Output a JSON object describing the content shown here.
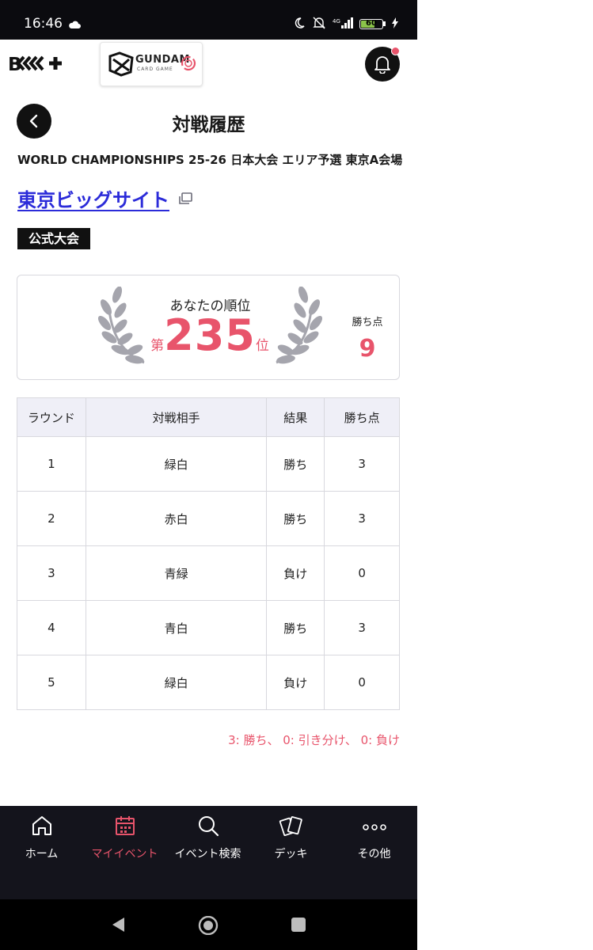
{
  "status_bar": {
    "time": "16:46",
    "battery": "60",
    "network": "4G"
  },
  "header": {
    "brand_logo": "B‹‹‹+",
    "partner_logo_text": "GUNDAM",
    "partner_logo_sub": "CARD GAME"
  },
  "page": {
    "title": "対戦履歴",
    "event_name": "WORLD CHAMPIONSHIPS 25-26 日本大会 エリア予選 東京A会場",
    "venue": "東京ビッグサイト",
    "badge": "公式大会"
  },
  "rank": {
    "caption": "あなたの順位",
    "prefix": "第",
    "value": "235",
    "suffix": "位",
    "points_caption": "勝ち点",
    "points_value": "9"
  },
  "table": {
    "headers": [
      "ラウンド",
      "対戦相手",
      "結果",
      "勝ち点"
    ],
    "rows": [
      {
        "round": "1",
        "opponent": "緑白",
        "result": "勝ち",
        "points": "3"
      },
      {
        "round": "2",
        "opponent": "赤白",
        "result": "勝ち",
        "points": "3"
      },
      {
        "round": "3",
        "opponent": "青緑",
        "result": "負け",
        "points": "0"
      },
      {
        "round": "4",
        "opponent": "青白",
        "result": "勝ち",
        "points": "3"
      },
      {
        "round": "5",
        "opponent": "緑白",
        "result": "負け",
        "points": "0"
      }
    ]
  },
  "legend_note": "3: 勝ち、 0: 引き分け、 0: 負け",
  "bottom_nav": [
    {
      "label": "ホーム",
      "icon": "home-icon"
    },
    {
      "label": "マイイベント",
      "icon": "calendar-icon",
      "active": true
    },
    {
      "label": "イベント検索",
      "icon": "search-icon"
    },
    {
      "label": "デッキ",
      "icon": "cards-icon"
    },
    {
      "label": "その他",
      "icon": "more-icon"
    }
  ],
  "colors": {
    "accent": "#e8546b",
    "link": "#2b2bd9",
    "dark": "#14141c"
  }
}
